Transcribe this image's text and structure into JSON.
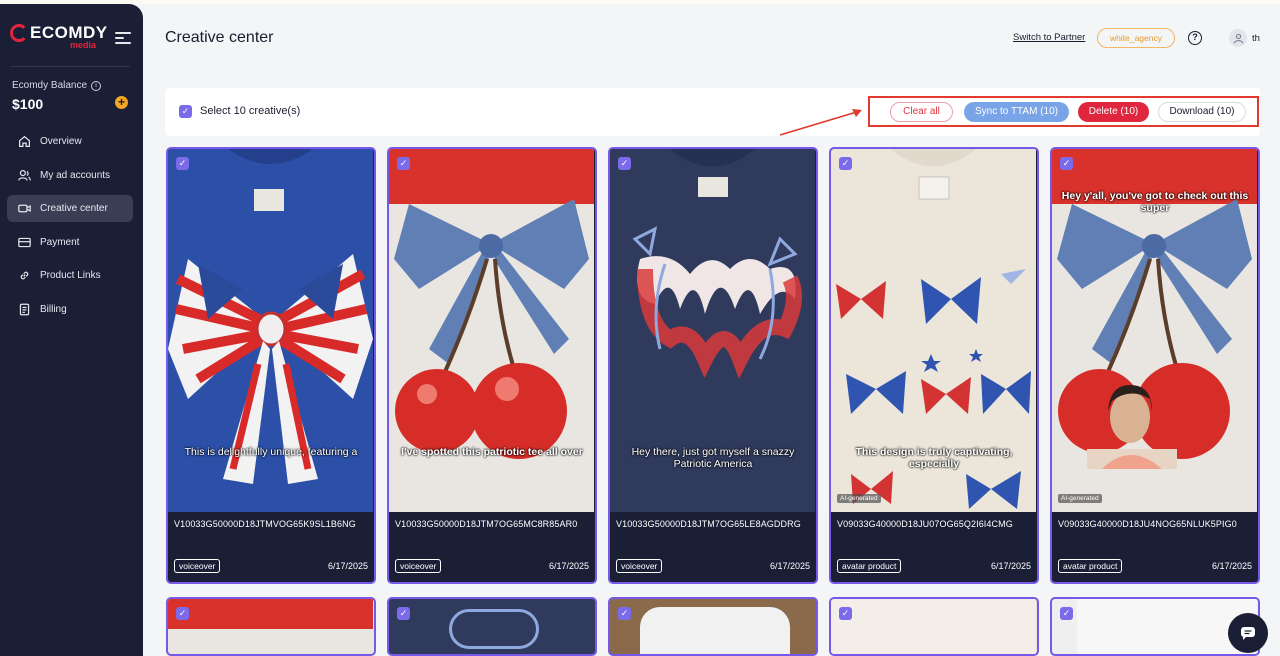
{
  "brand": {
    "name": "ECOMDY",
    "sub": "media"
  },
  "sidebar": {
    "balance_label": "Ecomdy Balance",
    "balance_value": "$100",
    "items": [
      {
        "label": "Overview",
        "icon": "home-icon"
      },
      {
        "label": "My ad accounts",
        "icon": "users-icon"
      },
      {
        "label": "Creative center",
        "icon": "video-camera-icon",
        "active": true
      },
      {
        "label": "Payment",
        "icon": "credit-card-icon"
      },
      {
        "label": "Product Links",
        "icon": "link-icon"
      },
      {
        "label": "Billing",
        "icon": "document-icon"
      }
    ]
  },
  "header": {
    "title": "Creative center",
    "switch_partner": "Switch to Partner",
    "agency": "white_agency",
    "user": "th"
  },
  "selection": {
    "label": "Select 10 creative(s)",
    "clear_all": "Clear all",
    "sync": "Sync to TTAM (10)",
    "delete": "Delete (10)",
    "download": "Download (10)"
  },
  "creatives": [
    {
      "id": "V10033G50000D18JTMVOG65K9SL1B6NG",
      "tag": "voiceover",
      "date": "6/17/2025",
      "caption": "This is delightfully unique, featuring a",
      "ai": ""
    },
    {
      "id": "V10033G50000D18JTM7OG65MC8R85AR0",
      "tag": "voiceover",
      "date": "6/17/2025",
      "caption": "I've spotted this patriotic tee all over",
      "ai": ""
    },
    {
      "id": "V10033G50000D18JTM7OG65LE8AGDDRG",
      "tag": "voiceover",
      "date": "6/17/2025",
      "caption": "Hey there, just got myself a snazzy Patriotic America",
      "ai": ""
    },
    {
      "id": "V09033G40000D18JU07OG65Q2I6I4CMG",
      "tag": "avatar product",
      "date": "6/17/2025",
      "caption": "This design is truly captivating, especially",
      "ai": "AI-generated"
    },
    {
      "id": "V09033G40000D18JU4NOG65NLUK5PIG0",
      "tag": "avatar product",
      "date": "6/17/2025",
      "caption": "Hey y'all, you've got to check out this super",
      "ai": "AI-generated"
    }
  ],
  "colors": {
    "accent": "#7659e8",
    "danger": "#e0253f",
    "sync": "#7aa4e8",
    "sidebar": "#1b1f36"
  }
}
